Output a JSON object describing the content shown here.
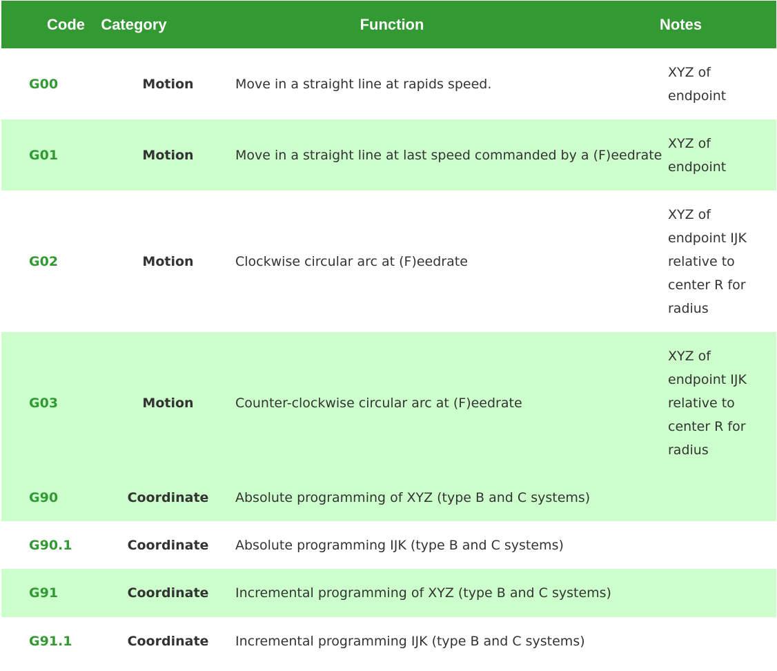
{
  "table": {
    "headers": {
      "code": "Code",
      "category": "Category",
      "function": "Function",
      "notes": "Notes"
    },
    "rows": [
      {
        "code": "G00",
        "category": "Motion",
        "function": "Move in a straight line at rapids speed.",
        "notes": "XYZ of endpoint"
      },
      {
        "code": "G01",
        "category": "Motion",
        "function": "Move in a straight line at last speed commanded by a (F)eedrate",
        "notes": "XYZ of endpoint"
      },
      {
        "code": "G02",
        "category": "Motion",
        "function": "Clockwise circular arc at (F)eedrate",
        "notes": "XYZ of endpoint IJK relative to center R for radius"
      },
      {
        "code": "G03",
        "category": "Motion",
        "function": "Counter-clockwise circular arc at (F)eedrate",
        "notes": "XYZ of endpoint IJK relative to center R for radius"
      },
      {
        "code": "G90",
        "category": "Coordinate",
        "function": "Absolute programming of XYZ (type B and C systems)",
        "notes": ""
      },
      {
        "code": "G90.1",
        "category": "Coordinate",
        "function": "Absolute programming IJK (type B and C systems)",
        "notes": ""
      },
      {
        "code": "G91",
        "category": "Coordinate",
        "function": "Incremental programming of XYZ (type B and C systems)",
        "notes": ""
      },
      {
        "code": "G91.1",
        "category": "Coordinate",
        "function": "Incremental programming IJK (type B and C systems)",
        "notes": ""
      }
    ]
  },
  "colors": {
    "header_bg": "#339933",
    "alt_row_bg": "#ccffcc",
    "code_text": "#339933"
  }
}
